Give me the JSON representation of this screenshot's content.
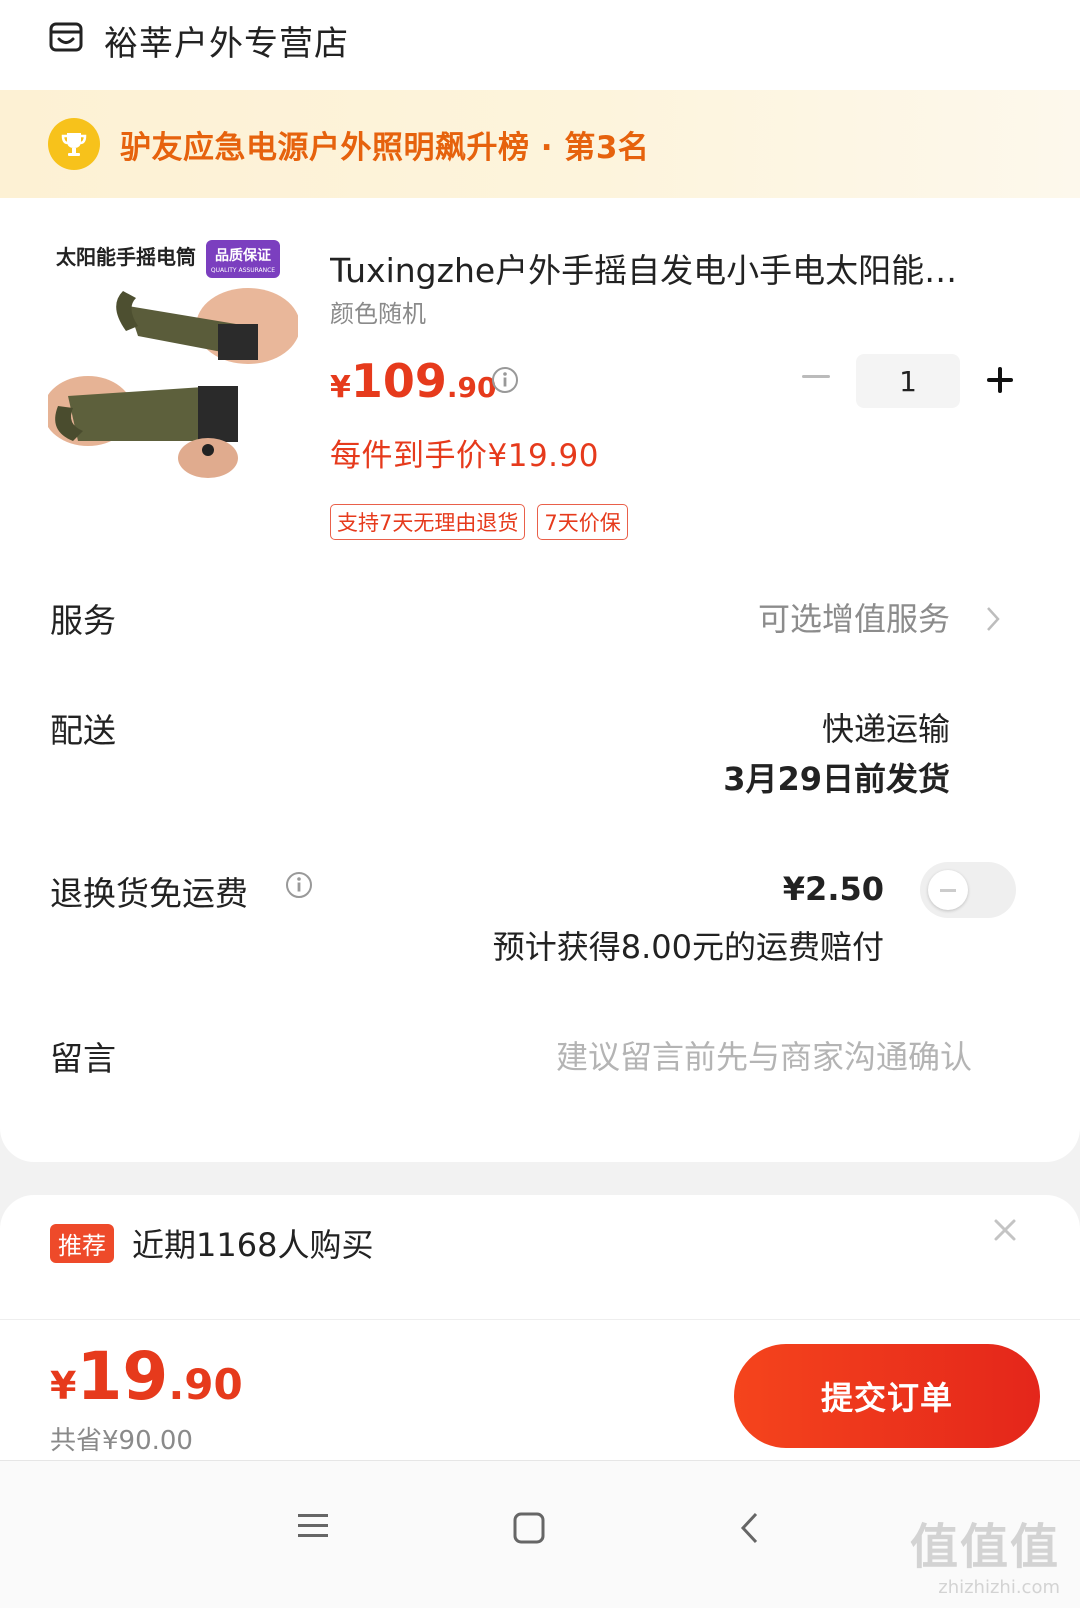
{
  "store": {
    "name": "裕莘户外专营店",
    "icon": "store-icon"
  },
  "ranking": {
    "text": "驴友应急电源户外照明飙升榜 · 第3名",
    "icon": "trophy-icon"
  },
  "product": {
    "title": "Tuxingzhe户外手摇自发电小手电太阳能…",
    "variant": "颜色随机",
    "price_symbol": "¥",
    "price_int": "109",
    "price_dec": ".90",
    "unit_price": "每件到手价¥19.90",
    "tags": [
      "支持7天无理由退货",
      "7天价保"
    ],
    "image_text_brand": "太阳能手摇电筒",
    "image_text_badge": "品质保证",
    "image_text_badge_sub": "QUALITY ASSURANCE",
    "quantity": "1"
  },
  "service": {
    "label": "服务",
    "value": "可选增值服务"
  },
  "delivery": {
    "label": "配送",
    "method": "快递运输",
    "ship_date": "3月29日前发货"
  },
  "return_shipping": {
    "label": "退换货免运费",
    "price": "¥2.50",
    "note": "预计获得8.00元的运费赔付",
    "enabled": false
  },
  "message": {
    "label": "留言",
    "placeholder": "建议留言前先与商家沟通确认"
  },
  "recommend": {
    "badge": "推荐",
    "text": "近期1168人购买"
  },
  "checkout": {
    "total_symbol": "¥",
    "total_int": "19",
    "total_dec": ".90",
    "saved": "共省¥90.00",
    "submit_label": "提交订单"
  },
  "watermark": {
    "big": "值值值",
    "small": "zhizhizhi.com"
  },
  "colors": {
    "accent": "#e63a1c",
    "rank": "#e6620d",
    "submit": "#f5441c"
  }
}
